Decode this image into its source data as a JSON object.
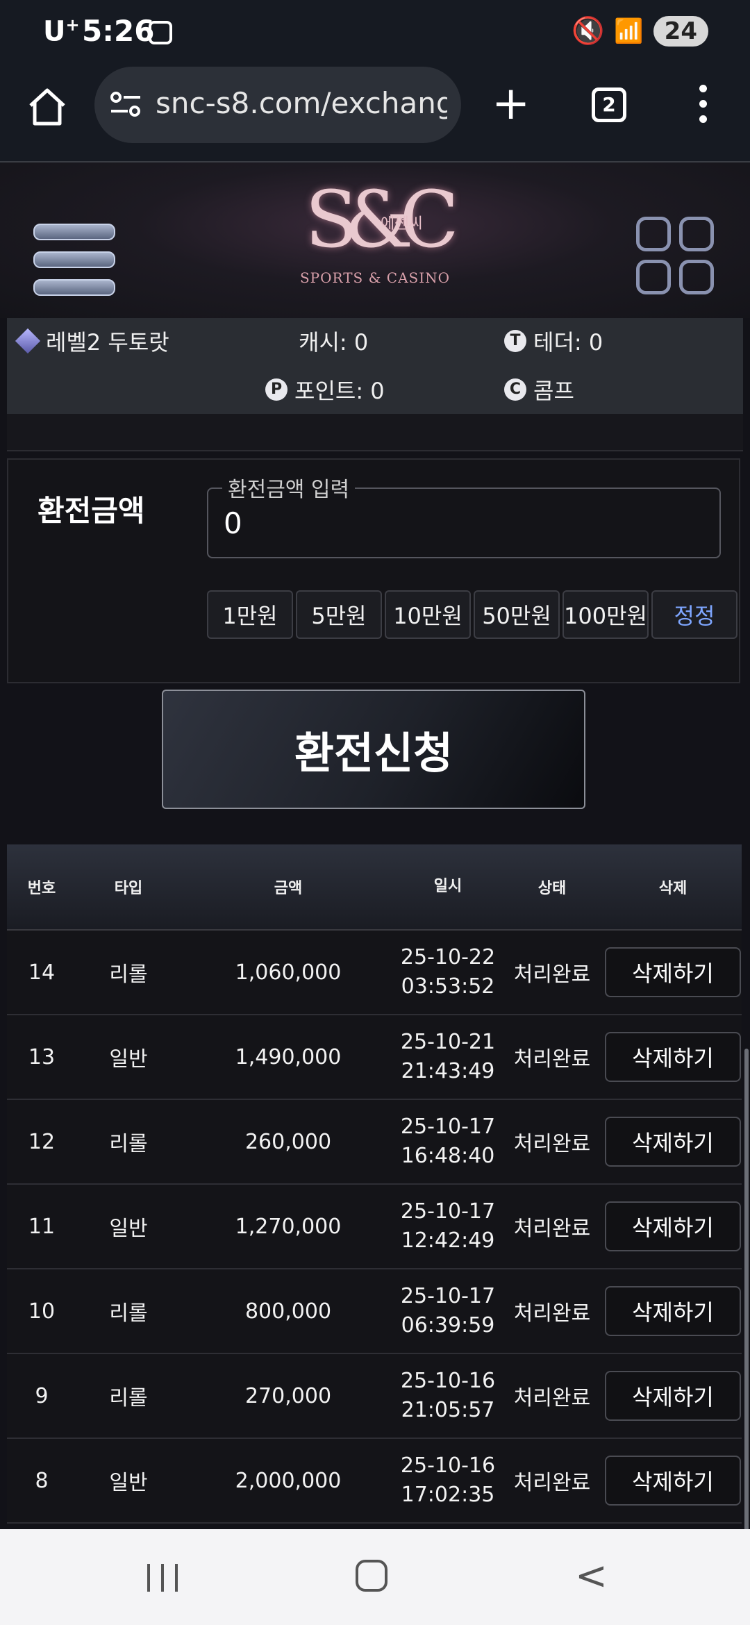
{
  "status_bar": {
    "carrier": "U",
    "carrier_sup": "+",
    "time": "5:26",
    "battery": "24"
  },
  "browser": {
    "url": "snc-s8.com/exchang",
    "tab_count": "2"
  },
  "logo": {
    "monogram": "S&C",
    "korean": "에쎈씨",
    "subtitle": "SPORTS & CASINO"
  },
  "user_info": {
    "level": "레벨2 두토랏",
    "cash": "캐시: 0",
    "tether": "테더: 0",
    "point": "포인트: 0",
    "comp": "콤프"
  },
  "exchange": {
    "label": "환전금액",
    "field_legend": "환전금액 입력",
    "value": "0",
    "quick_amounts": [
      "1만원",
      "5만원",
      "10만원",
      "50만원",
      "100만원"
    ],
    "reset_label": "정정",
    "submit_label": "환전신청"
  },
  "table": {
    "headers": [
      "번호",
      "타입",
      "금액",
      "일시",
      "상태",
      "삭제"
    ],
    "rows": [
      {
        "no": "14",
        "type": "리롤",
        "amount": "1,060,000",
        "date": "25-10-22",
        "time": "03:53:52",
        "status": "처리완료",
        "action": "삭제하기"
      },
      {
        "no": "13",
        "type": "일반",
        "amount": "1,490,000",
        "date": "25-10-21",
        "time": "21:43:49",
        "status": "처리완료",
        "action": "삭제하기"
      },
      {
        "no": "12",
        "type": "리롤",
        "amount": "260,000",
        "date": "25-10-17",
        "time": "16:48:40",
        "status": "처리완료",
        "action": "삭제하기"
      },
      {
        "no": "11",
        "type": "일반",
        "amount": "1,270,000",
        "date": "25-10-17",
        "time": "12:42:49",
        "status": "처리완료",
        "action": "삭제하기"
      },
      {
        "no": "10",
        "type": "리롤",
        "amount": "800,000",
        "date": "25-10-17",
        "time": "06:39:59",
        "status": "처리완료",
        "action": "삭제하기"
      },
      {
        "no": "9",
        "type": "리롤",
        "amount": "270,000",
        "date": "25-10-16",
        "time": "21:05:57",
        "status": "처리완료",
        "action": "삭제하기"
      },
      {
        "no": "8",
        "type": "일반",
        "amount": "2,000,000",
        "date": "25-10-16",
        "time": "17:02:35",
        "status": "처리완료",
        "action": "삭제하기"
      }
    ]
  },
  "colors": {
    "accent_link": "#7ea6ff",
    "panel_bg": "#141418",
    "info_bg": "#2a2d33"
  }
}
